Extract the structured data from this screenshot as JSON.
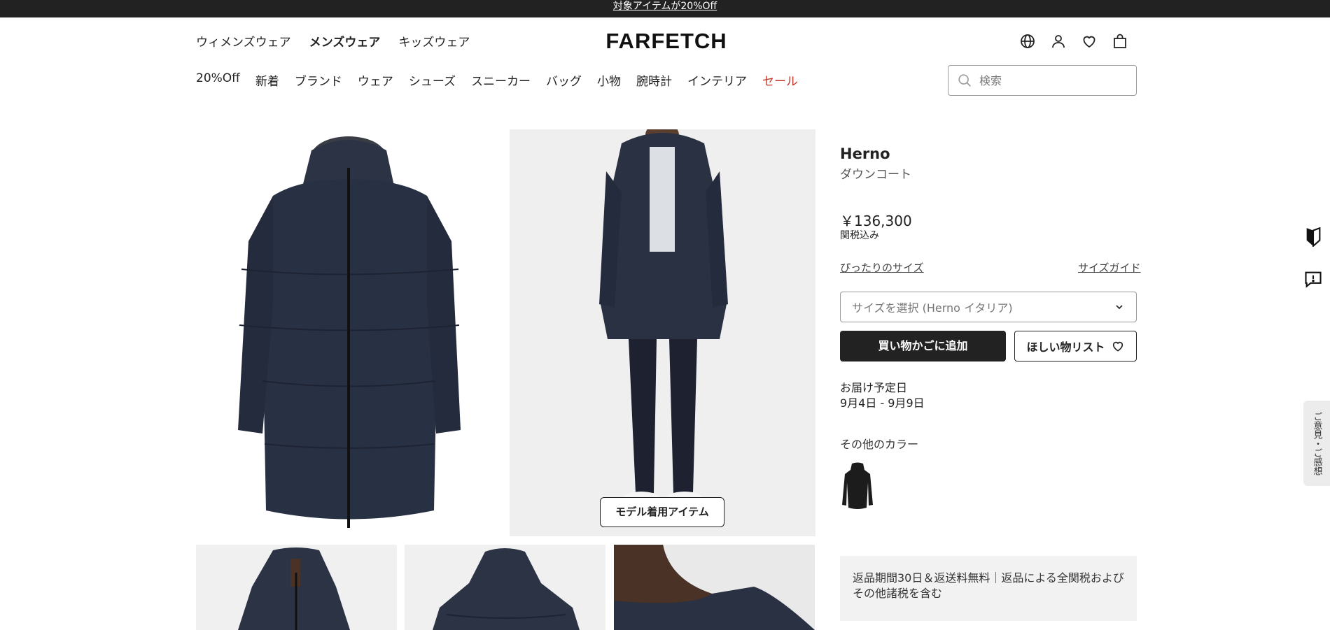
{
  "promo": {
    "text": "対象アイテムが20%Off"
  },
  "departments": [
    {
      "label": "ウィメンズウェア",
      "active": false
    },
    {
      "label": "メンズウェア",
      "active": true
    },
    {
      "label": "キッズウェア",
      "active": false
    }
  ],
  "logo": {
    "text": "FARFETCH"
  },
  "header_icons": [
    "globe-icon",
    "account-icon",
    "wishlist-heart-icon",
    "shopping-bag-icon"
  ],
  "categories": [
    {
      "label": "20%Off"
    },
    {
      "label": "新着"
    },
    {
      "label": "ブランド"
    },
    {
      "label": "ウェア"
    },
    {
      "label": "シューズ"
    },
    {
      "label": "スニーカー"
    },
    {
      "label": "バッグ"
    },
    {
      "label": "小物"
    },
    {
      "label": "腕時計"
    },
    {
      "label": "インテリア"
    },
    {
      "label": "セール",
      "highlight": true
    }
  ],
  "search": {
    "placeholder": "検索",
    "value": ""
  },
  "gallery": {
    "model_badge": "モデル着用アイテム"
  },
  "product": {
    "brand": "Herno",
    "name": "ダウンコート",
    "price": "￥136,300",
    "tax_note": "関税込み",
    "fit_link": "ぴったりのサイズ",
    "size_guide_link": "サイズガイド",
    "size_select_placeholder": "サイズを選択 (Herno イタリア)",
    "add_to_bag": "買い物かごに追加",
    "wishlist": "ほしい物リスト",
    "delivery_label": "お届け予定日",
    "delivery_date": "9月4日 - 9月9日",
    "other_colors_label": "その他のカラー",
    "returns_text": "返品期間30日＆返送料無料｜返品による全関税および その他諸税を含む"
  },
  "side": {
    "feedback_label": "ご意見・ご感想"
  },
  "colors": {
    "accent_sale": "#c0392b",
    "dark": "#222222",
    "navy_coat": "#273044"
  }
}
